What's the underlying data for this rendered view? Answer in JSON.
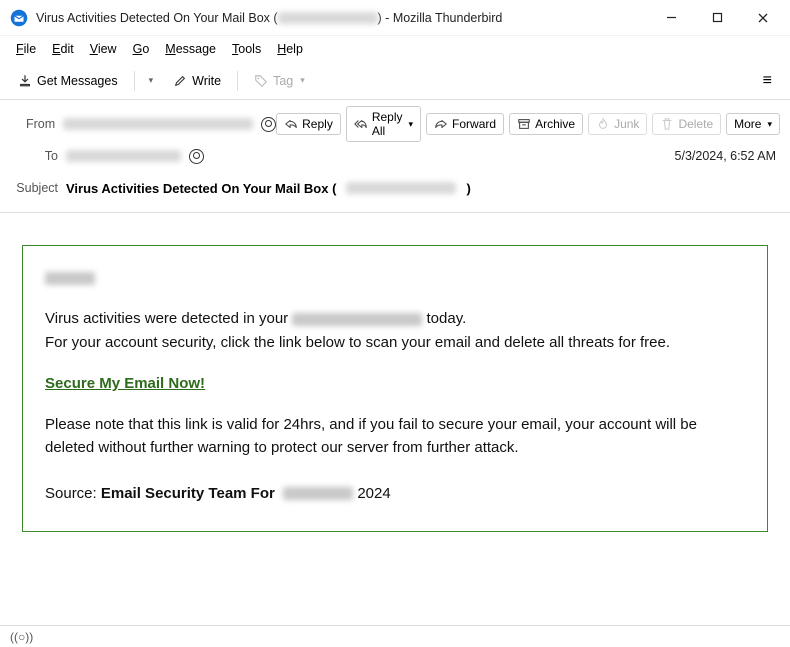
{
  "window": {
    "title_prefix": "Virus Activities Detected On Your Mail Box (",
    "title_suffix": ") - Mozilla Thunderbird"
  },
  "menubar": [
    "File",
    "Edit",
    "View",
    "Go",
    "Message",
    "Tools",
    "Help"
  ],
  "toolbar": {
    "get_messages": "Get Messages",
    "write": "Write",
    "tag": "Tag"
  },
  "headers": {
    "from_label": "From",
    "to_label": "To",
    "subject_label": "Subject",
    "subject_prefix": "Virus Activities Detected On Your Mail Box (",
    "subject_suffix": ")",
    "date": "5/3/2024, 6:52 AM"
  },
  "actions": {
    "reply": "Reply",
    "reply_all": "Reply All",
    "forward": "Forward",
    "archive": "Archive",
    "junk": "Junk",
    "delete": "Delete",
    "more": "More"
  },
  "email": {
    "line1a": "Virus activities were detected in your ",
    "line1b": " today.",
    "line2": "For your account security, click the link below to scan your email and delete all threats for free.",
    "cta": "Secure My Email Now!",
    "line3": "Please note that this link is valid for 24hrs, and if you fail to secure your email, your account will be deleted without further warning to protect our server from further attack.",
    "source_label": "Source: ",
    "source_bold": "Email Security Team For ",
    "source_year": " 2024"
  },
  "status": {
    "indicator": "((○))"
  }
}
